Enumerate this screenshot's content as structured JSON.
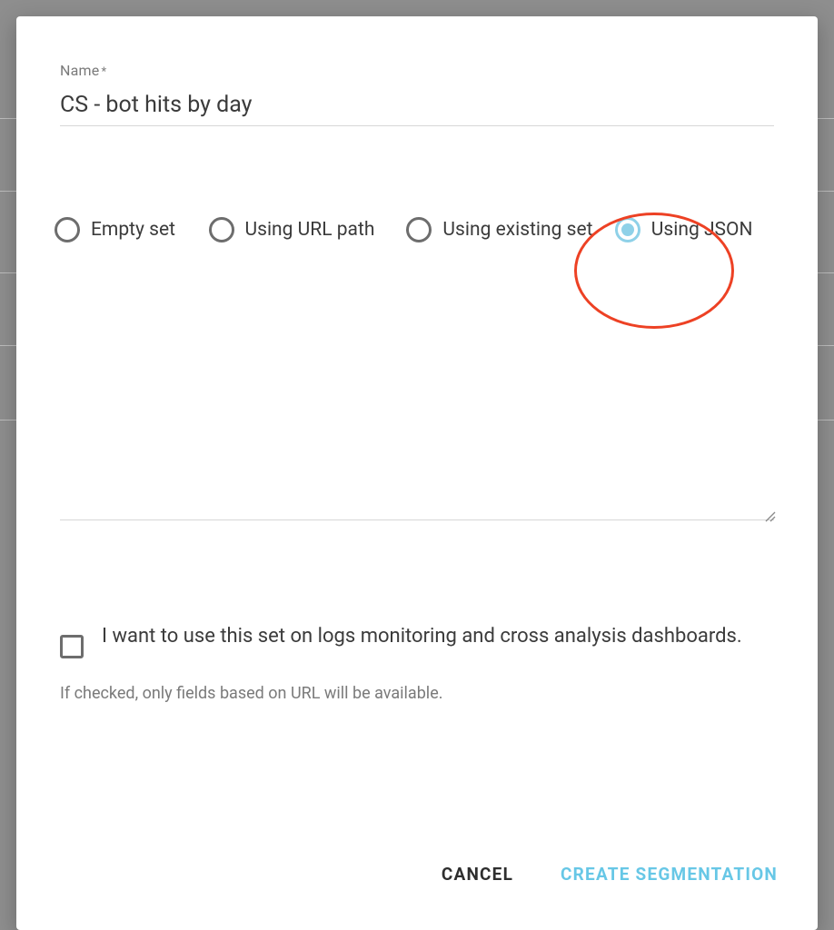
{
  "form": {
    "name_label": "Name",
    "name_required_mark": "*",
    "name_value": "CS - bot hits by day"
  },
  "options": {
    "items": [
      {
        "label": "Empty set",
        "selected": false
      },
      {
        "label": "Using URL path",
        "selected": false
      },
      {
        "label": "Using existing set",
        "selected": false
      },
      {
        "label": "Using JSON",
        "selected": true
      }
    ]
  },
  "json_textarea": {
    "value": ""
  },
  "checkbox": {
    "label": "I want to use this set on logs monitoring and cross analysis dashboards.",
    "checked": false,
    "hint": "If checked, only fields based on URL will be available."
  },
  "actions": {
    "cancel": "CANCEL",
    "create": "CREATE SEGMENTATION"
  },
  "colors": {
    "accent": "#67c7e6",
    "highlight": "#ed4124"
  }
}
